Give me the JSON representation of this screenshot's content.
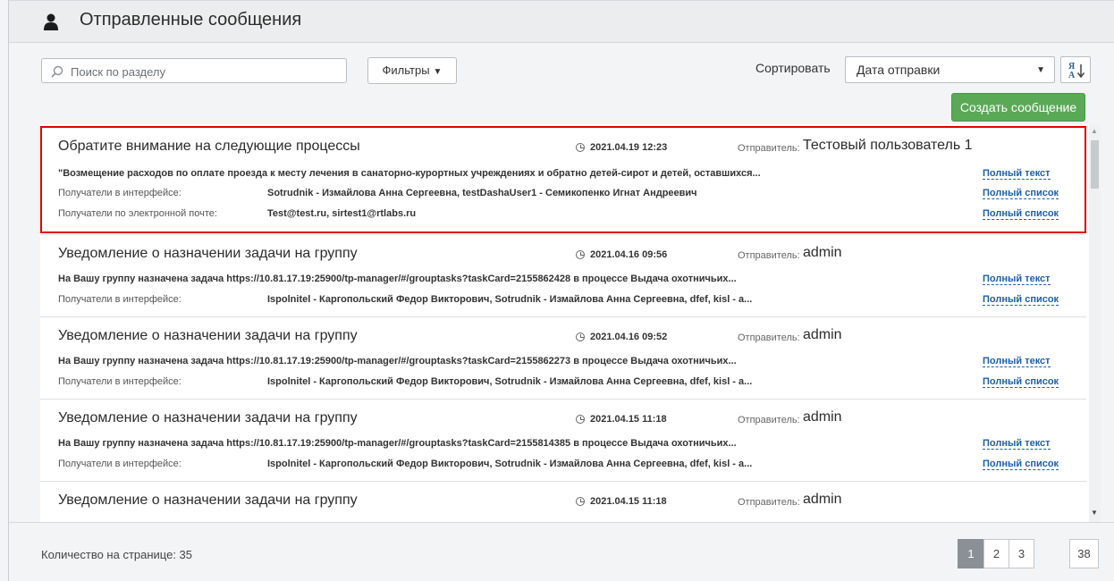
{
  "header": {
    "title": "Отправленные сообщения",
    "icon": "user-icon"
  },
  "toolbar": {
    "search_placeholder": "Поиск по разделу",
    "filters_label": "Фильтры",
    "sort_label": "Сортировать",
    "sort_value": "Дата отправки",
    "create_label": "Создать сообщение"
  },
  "messages": [
    {
      "subject": "Обратите внимание на следующие процессы",
      "date": "2021.04.19 12:23",
      "sender_label": "Отправитель:",
      "sender": "Тестовый пользователь 1",
      "body": "\"Возмещение расходов по оплате проезда к месту лечения в санаторно-курортных учреждениях и обратно детей-сирот и детей, оставшихся...",
      "recipients_ui_label": "Получатели в интерфейсе:",
      "recipients_ui": "Sotrudnik - Измайлова Анна Сергеевна, testDashaUser1 - Семикопенко Игнат Андреевич",
      "recipients_email_label": "Получатели по электронной почте:",
      "recipients_email": "Test@test.ru, sirtest1@rtlabs.ru",
      "full_text": "Полный текст",
      "full_list": "Полный список",
      "full_list_email": "Полный список"
    },
    {
      "subject": "Уведомление о назначении задачи на группу",
      "date": "2021.04.16 09:56",
      "sender_label": "Отправитель:",
      "sender": "admin",
      "body": "На Вашу группу назначена задача https://10.81.17.19:25900/tp-manager/#/grouptasks?taskCard=2155862428 в процессе Выдача охотничьих...",
      "recipients_ui_label": "Получатели в интерфейсе:",
      "recipients_ui": "Ispolnitel - Каргопольский Федор Викторович, Sotrudnik - Измайлова Анна Сергеевна, dfef, kisl - а...",
      "full_text": "Полный текст",
      "full_list": "Полный список"
    },
    {
      "subject": "Уведомление о назначении задачи на группу",
      "date": "2021.04.16 09:52",
      "sender_label": "Отправитель:",
      "sender": "admin",
      "body": "На Вашу группу назначена задача https://10.81.17.19:25900/tp-manager/#/grouptasks?taskCard=2155862273 в процессе Выдача охотничьих...",
      "recipients_ui_label": "Получатели в интерфейсе:",
      "recipients_ui": "Ispolnitel - Каргопольский Федор Викторович, Sotrudnik - Измайлова Анна Сергеевна, dfef, kisl - а...",
      "full_text": "Полный текст",
      "full_list": "Полный список"
    },
    {
      "subject": "Уведомление о назначении задачи на группу",
      "date": "2021.04.15 11:18",
      "sender_label": "Отправитель:",
      "sender": "admin",
      "body": "На Вашу группу назначена задача https://10.81.17.19:25900/tp-manager/#/grouptasks?taskCard=2155814385 в процессе Выдача охотничьих...",
      "recipients_ui_label": "Получатели в интерфейсе:",
      "recipients_ui": "Ispolnitel - Каргопольский Федор Викторович, Sotrudnik - Измайлова Анна Сергеевна, dfef, kisl - а...",
      "full_text": "Полный текст",
      "full_list": "Полный список"
    },
    {
      "subject": "Уведомление о назначении задачи на группу",
      "date": "2021.04.15 11:18",
      "sender_label": "Отправитель:",
      "sender": "admin"
    }
  ],
  "footer": {
    "per_page": "Количество на странице: 35",
    "pages": [
      "1",
      "2",
      "3",
      "38"
    ],
    "active_page": "1"
  },
  "colors": {
    "accent_green": "#5aa957",
    "highlight_border": "#e00000",
    "link": "#1f5fa8"
  }
}
